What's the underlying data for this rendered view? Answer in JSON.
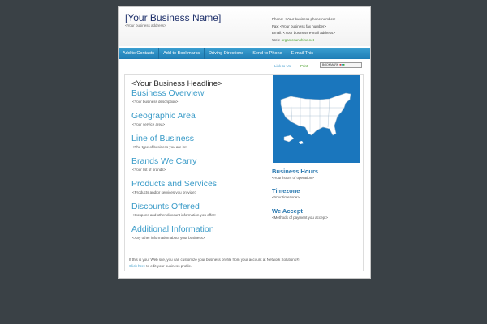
{
  "header": {
    "business_name": "[Your Business Name]",
    "business_address": "<Your business address>",
    "phone": "Phone: <Your business phone number>",
    "fax": "Fax: <Your business fax number>",
    "email": "Email: <Your business e-mail address>",
    "web_label": "Web: ",
    "web_link": "organicsunshine.net"
  },
  "nav": {
    "items": [
      "Add to Contacts",
      "Add to Bookmarks",
      "Driving Directions",
      "Send to Phone",
      "E-mail This"
    ]
  },
  "utility": {
    "link_to_us": "Link to Us",
    "print": "Print",
    "bookmark": "BOOKMARK"
  },
  "main": {
    "headline": "<Your Business Headline>",
    "sections": [
      {
        "title": "Business Overview",
        "desc": "<Your business description>"
      },
      {
        "title": "Geographic Area",
        "desc": "<Your service area>"
      },
      {
        "title": "Line of Business",
        "desc": "<The type of business you are in>"
      },
      {
        "title": "Brands We Carry",
        "desc": "<Your list of brands>"
      },
      {
        "title": "Products and Services",
        "desc": "<Products and/or services you provide>"
      },
      {
        "title": "Discounts Offered",
        "desc": "<Coupons and other discount information you offer>"
      },
      {
        "title": "Additional Information",
        "desc": "<Any other information about your business>"
      }
    ]
  },
  "sidebar": {
    "sections": [
      {
        "title": "Business Hours",
        "desc": "<Your hours of operation>"
      },
      {
        "title": "Timezone",
        "desc": "<Your timezone>"
      },
      {
        "title": "We Accept",
        "desc": "<Methods of payment you accept>"
      }
    ]
  },
  "footer": {
    "line1": "If this is your Web site, you can customize your business profile from your account at Network Solutions®.",
    "click_here": "Click here",
    "line2_rest": " to edit your business profile."
  },
  "colors": {
    "background": "#3a4146",
    "nav": "#2a8cc4",
    "accent": "#3a9bc8",
    "map": "#1a76bd"
  }
}
